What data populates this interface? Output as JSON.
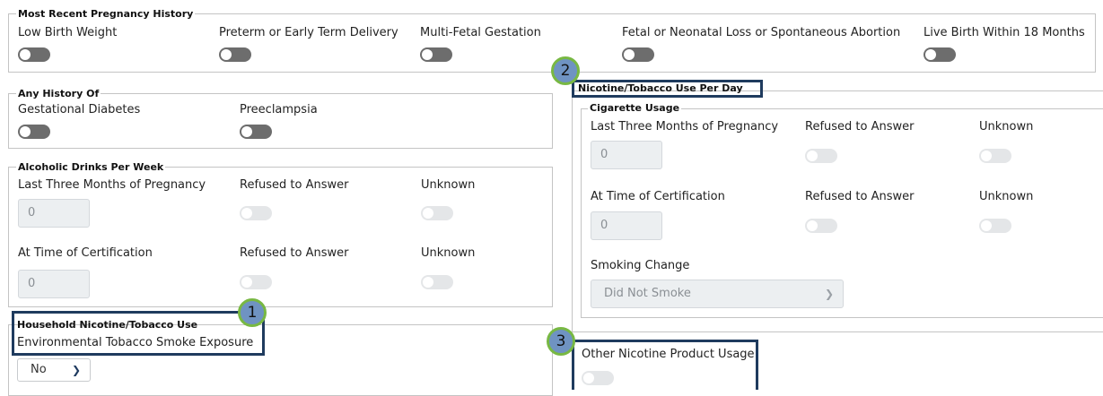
{
  "pregnancy_history": {
    "legend": "Most Recent Pregnancy History",
    "items": [
      {
        "label": "Low Birth Weight"
      },
      {
        "label": "Preterm or Early Term Delivery"
      },
      {
        "label": "Multi-Fetal Gestation"
      },
      {
        "label": "Fetal or Neonatal Loss or Spontaneous Abortion"
      },
      {
        "label": "Live Birth Within 18 Months"
      }
    ]
  },
  "any_history": {
    "legend": "Any History Of",
    "items": [
      {
        "label": "Gestational Diabetes"
      },
      {
        "label": "Preeclampsia"
      }
    ]
  },
  "alcohol": {
    "legend": "Alcoholic Drinks Per Week",
    "last_three_months": "Last Three Months of Pregnancy",
    "refused": "Refused to Answer",
    "unknown": "Unknown",
    "value1": "0",
    "at_certification": "At Time of Certification",
    "refused2": "Refused to Answer",
    "unknown2": "Unknown",
    "value2": "0"
  },
  "household": {
    "legend": "Household Nicotine/Tobacco Use",
    "exposure_label": "Environmental Tobacco Smoke Exposure",
    "exposure_value": "No"
  },
  "nicotine": {
    "legend": "Nicotine/Tobacco Use Per Day",
    "cigarette": {
      "legend": "Cigarette Usage",
      "last_three_months": "Last Three Months of Pregnancy",
      "refused": "Refused to Answer",
      "unknown": "Unknown",
      "value1": "0",
      "at_certification": "At Time of Certification",
      "refused2": "Refused to Answer",
      "unknown2": "Unknown",
      "value2": "0",
      "smoking_change_label": "Smoking Change",
      "smoking_change_value": "Did Not Smoke"
    },
    "other_label": "Other Nicotine Product Usage"
  },
  "callouts": [
    "1",
    "2",
    "3"
  ],
  "colors": {
    "highlight": "#1f3b5e",
    "badge_fill": "#6f93c2",
    "badge_ring": "#78b843",
    "toggle_off": "#6d6d6d"
  }
}
